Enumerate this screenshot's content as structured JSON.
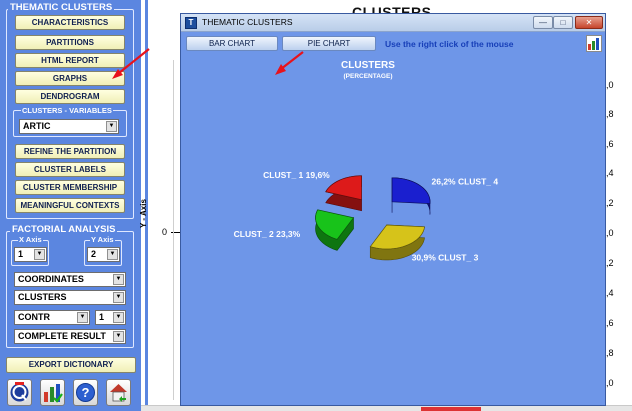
{
  "left_panel": {
    "clusters_section": {
      "title": "THEMATIC CLUSTERS",
      "buttons": [
        "CHARACTERISTICS",
        "PARTITIONS",
        "HTML REPORT",
        "GRAPHS",
        "DENDROGRAM"
      ],
      "variables_label": "CLUSTERS - VARIABLES",
      "variables_value": "ARTIC",
      "buttons2": [
        "REFINE THE PARTITION",
        "CLUSTER LABELS",
        "CLUSTER MEMBERSHIP",
        "MEANINGFUL CONTEXTS"
      ]
    },
    "factorial_section": {
      "title": "FACTORIAL ANALYSIS",
      "x_axis_label": "X Axis",
      "x_axis_value": "1",
      "y_axis_label": "Y Axis",
      "y_axis_value": "2",
      "coordinates_value": "COORDINATES",
      "clusters_value": "CLUSTERS",
      "contr_value": "CONTR",
      "contr_num_value": "1",
      "result_value": "COMPLETE RESULT"
    },
    "export_button": "EXPORT DICTIONARY",
    "icon_buttons": [
      "q-logo-icon",
      "chart-icon",
      "help-icon",
      "home-icon"
    ]
  },
  "background": {
    "title": "CLUSTERS",
    "y_axis_label": "Y - Axis",
    "zero_label": "0",
    "right_ticks": [
      ",0",
      ",8",
      ",6",
      ",4",
      ",2",
      ",0",
      ",2",
      ",4",
      ",6",
      ",8",
      ",0"
    ]
  },
  "dialog": {
    "title": "THEMATIC CLUSTERS",
    "bar_chart_button": "BAR CHART",
    "pie_chart_button": "PIE CHART",
    "hint": "Use the right click of the mouse",
    "chart_title": "CLUSTERS",
    "chart_subtitle": "(PERCENTAGE)"
  },
  "chart_data": {
    "type": "pie",
    "title": "CLUSTERS",
    "subtitle": "(PERCENTAGE)",
    "slices": [
      {
        "label": "CLUST_ 1",
        "value": 19.6,
        "value_text": "19,6%",
        "color": "#dd1a1a"
      },
      {
        "label": "CLUST_ 2",
        "value": 23.3,
        "value_text": "23,3%",
        "color": "#18c31a"
      },
      {
        "label": "CLUST_ 3",
        "value": 30.9,
        "value_text": "30,9%",
        "color": "#d6c31a"
      },
      {
        "label": "CLUST_ 4",
        "value": 26.2,
        "value_text": "26,2%",
        "color": "#1a1fcf"
      }
    ]
  },
  "colors": {
    "panel_background": "#5b86e0",
    "dialog_background": "#6e96e8",
    "button_yellow": "#f8f7c8",
    "hint_text": "#173fb8",
    "annotation_arrow": "#e8121b"
  }
}
